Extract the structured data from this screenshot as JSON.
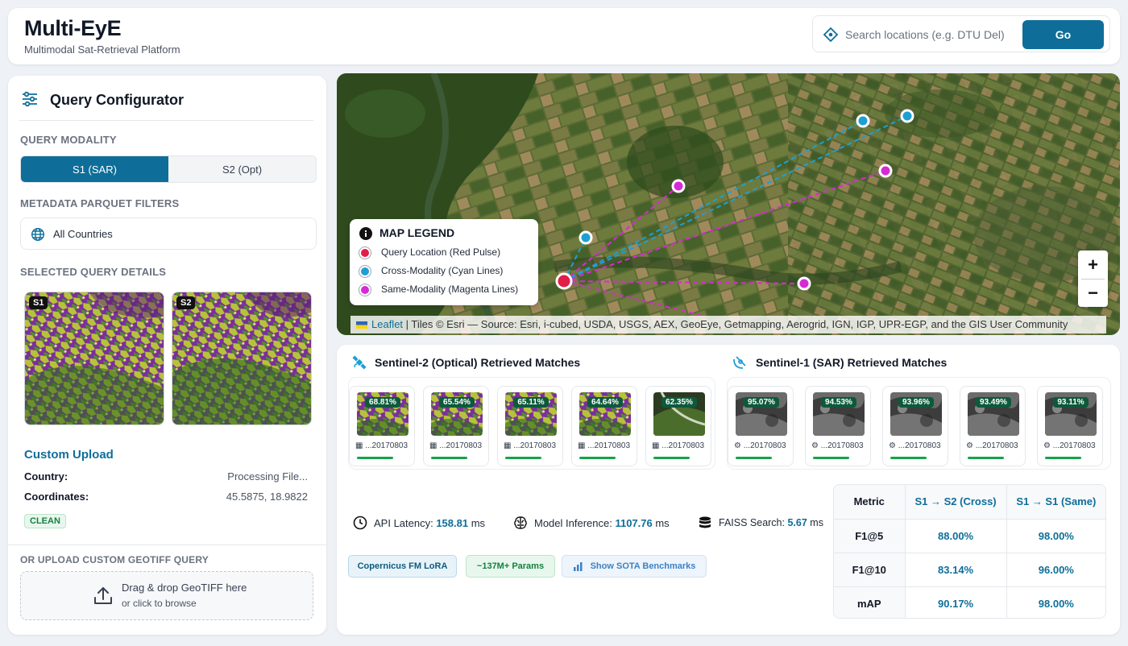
{
  "header": {
    "title": "Multi-EyE",
    "subtitle": "Multimodal Sat-Retrieval Platform",
    "search_placeholder": "Search locations (e.g. DTU Del)",
    "go_label": "Go"
  },
  "configurator": {
    "title": "Query Configurator",
    "modality_label": "QUERY MODALITY",
    "modalities": [
      "S1 (SAR)",
      "S2 (Opt)"
    ],
    "active_modality": "S1 (SAR)",
    "filters_label": "METADATA PARQUET FILTERS",
    "country_filter": "All Countries",
    "details_label": "SELECTED QUERY DETAILS",
    "thumb_tags": [
      "S1",
      "S2"
    ],
    "custom_upload_title": "Custom Upload",
    "country_key": "Country:",
    "country_value": "Processing File...",
    "coords_key": "Coordinates:",
    "coords_value": "45.5875, 18.9822",
    "badge": "CLEAN",
    "upload_label": "OR UPLOAD CUSTOM GEOTIFF QUERY",
    "dropzone_line1": "Drag & drop GeoTIFF here",
    "dropzone_line2": "or click to browse"
  },
  "map": {
    "legend_title": "MAP LEGEND",
    "legend_items": [
      {
        "label": "Query Location (Red Pulse)",
        "color": "#e11d48"
      },
      {
        "label": "Cross-Modality (Cyan Lines)",
        "color": "#1e9fd4"
      },
      {
        "label": "Same-Modality (Magenta Lines)",
        "color": "#d62ad6"
      }
    ],
    "zoom_in": "+",
    "zoom_out": "−",
    "attribution_link": "Leaflet",
    "attribution_text": " | Tiles © Esri — Source: Esri, i-cubed, USDA, USGS, AEX, GeoEye, Getmapping, Aerogrid, IGN, IGP, UPR-EGP, and the GIS User Community"
  },
  "results": {
    "optical_title": "Sentinel-2 (Optical) Retrieved Matches",
    "sar_title": "Sentinel-1 (SAR) Retrieved Matches",
    "optical_matches": [
      {
        "score": "68.81%",
        "date": "...20170803"
      },
      {
        "score": "65.54%",
        "date": "...20170803"
      },
      {
        "score": "65.11%",
        "date": "...20170803"
      },
      {
        "score": "64.64%",
        "date": "...20170803"
      },
      {
        "score": "62.35%",
        "date": "...20170803"
      }
    ],
    "sar_matches": [
      {
        "score": "95.07%",
        "date": "...20170803"
      },
      {
        "score": "94.53%",
        "date": "...20170803"
      },
      {
        "score": "93.96%",
        "date": "...20170803"
      },
      {
        "score": "93.49%",
        "date": "...20170803"
      },
      {
        "score": "93.11%",
        "date": "...20170803"
      }
    ],
    "stats": {
      "latency_label": "API Latency: ",
      "latency_value": "158.81",
      "latency_unit": " ms",
      "inference_label": "Model Inference: ",
      "inference_value": "1107.76",
      "inference_unit": " ms",
      "faiss_label": "FAISS Search: ",
      "faiss_value": "5.67",
      "faiss_unit": " ms"
    },
    "tags": {
      "model": "Copernicus FM LoRA",
      "params": "~137M+ Params",
      "benchmarks": "Show SOTA Benchmarks"
    },
    "metrics_table": {
      "headers": [
        "Metric",
        "S1 → S2 (Cross)",
        "S1 → S1 (Same)"
      ],
      "rows": [
        [
          "F1@5",
          "88.00%",
          "98.00%"
        ],
        [
          "F1@10",
          "83.14%",
          "96.00%"
        ],
        [
          "mAP",
          "90.17%",
          "98.00%"
        ]
      ]
    }
  },
  "colors": {
    "accent": "#0e6e99",
    "query_red": "#e11d48",
    "cross_cyan": "#1e9fd4",
    "same_magenta": "#d62ad6",
    "score_green": "#0d5a3b"
  }
}
